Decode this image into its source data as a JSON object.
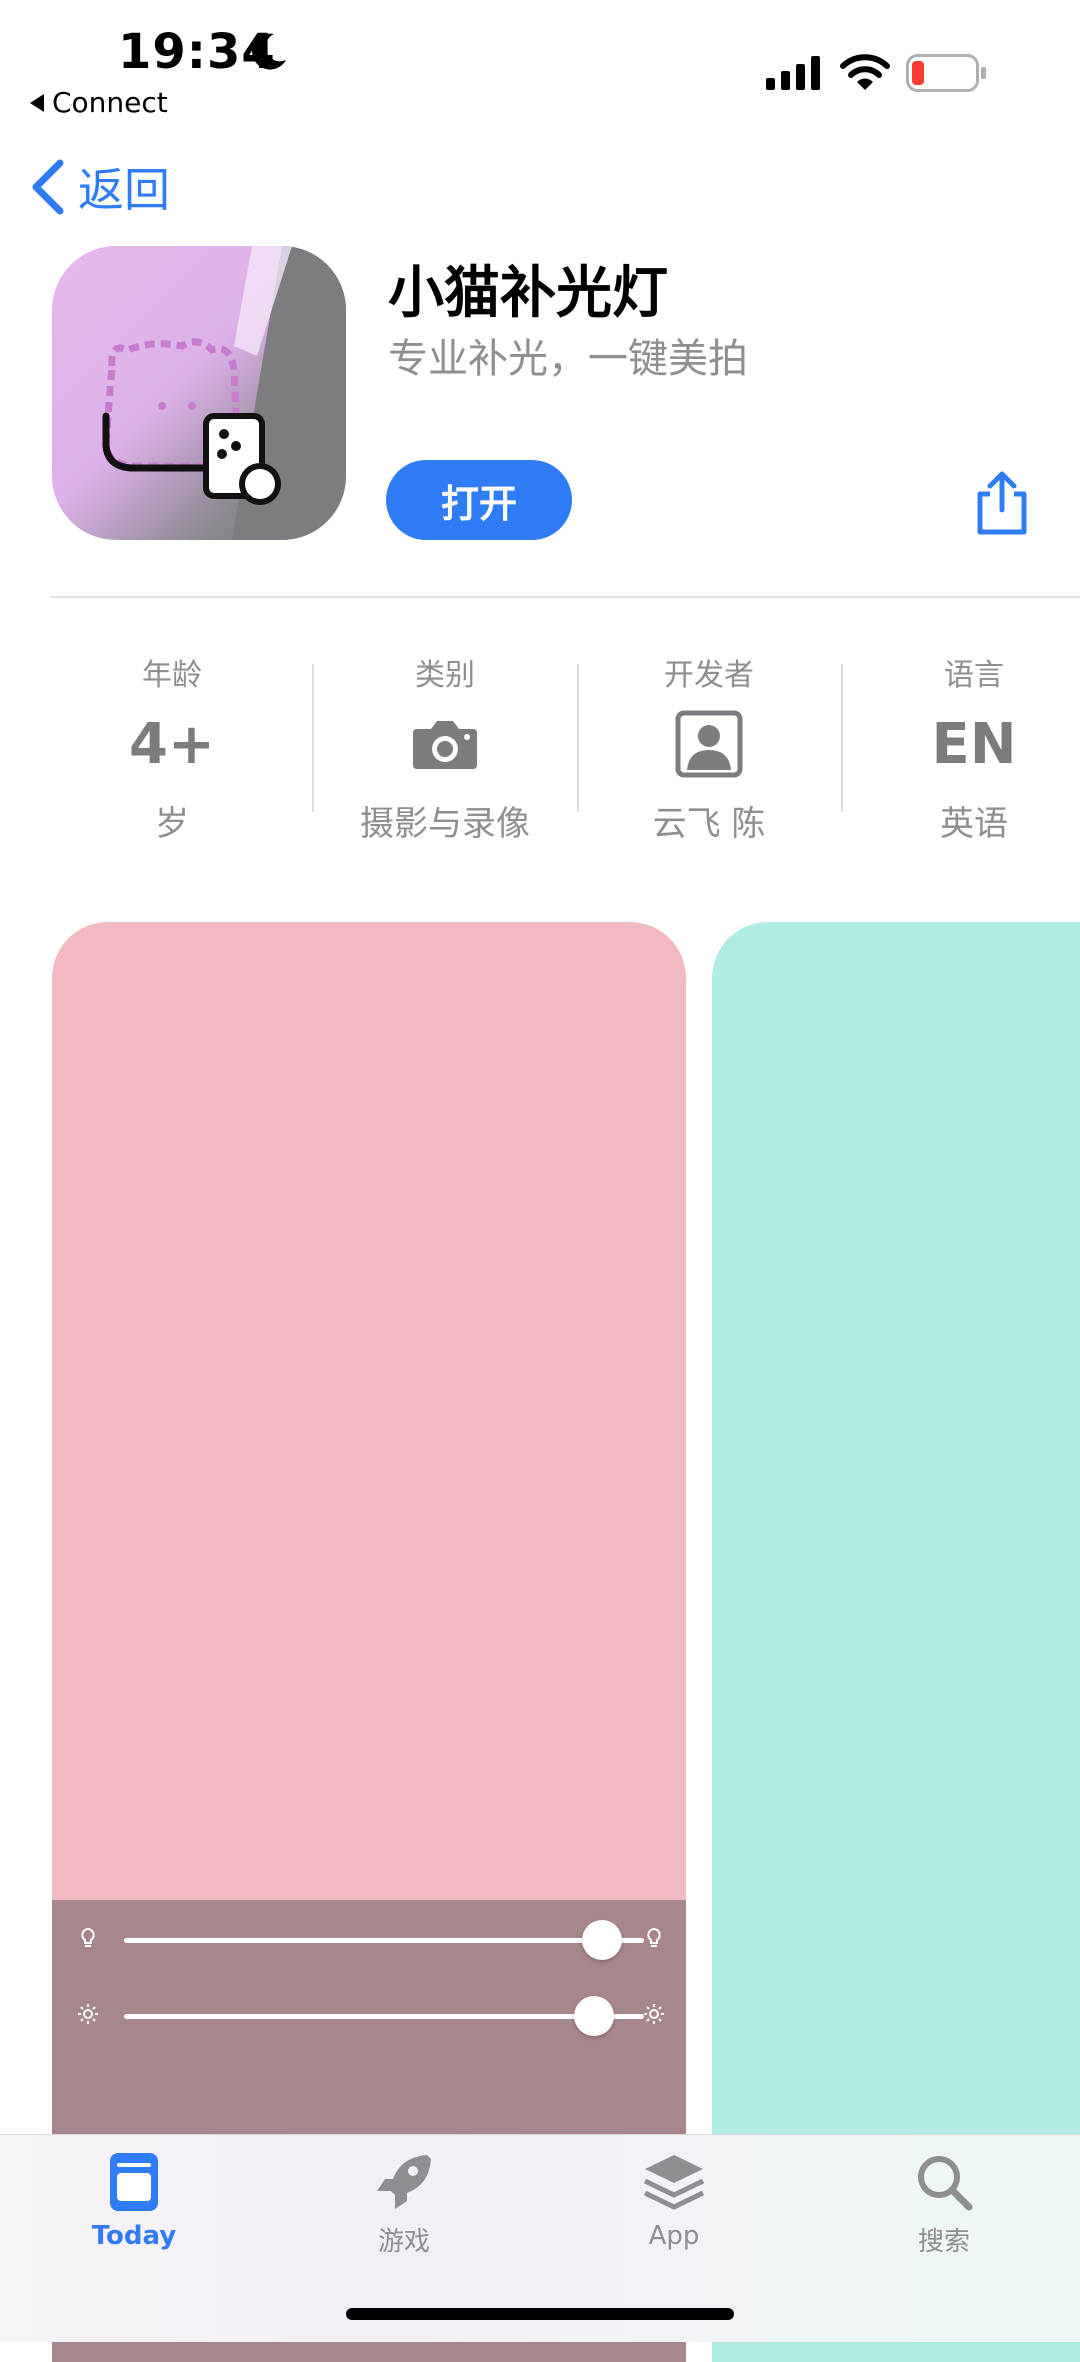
{
  "status_bar": {
    "time": "19:34",
    "back_app": "Connect"
  },
  "nav": {
    "back_label": "返回"
  },
  "app": {
    "name": "小猫补光灯",
    "subtitle": "专业补光，一键美拍",
    "open_label": "打开"
  },
  "info": [
    {
      "label": "年龄",
      "value": "4+",
      "sub": "岁"
    },
    {
      "label": "类别",
      "icon": "camera-icon",
      "sub": "摄影与录像"
    },
    {
      "label": "开发者",
      "icon": "person-icon",
      "sub": "云飞 陈"
    },
    {
      "label": "语言",
      "value": "EN",
      "sub": "英语"
    }
  ],
  "screenshots": {
    "shot1_color": "#f2b9c0",
    "shot2_color": "#b0ebe4",
    "slider_levels": [
      0.99,
      0.98
    ]
  },
  "tabs": [
    {
      "label": "Today",
      "icon": "today-icon",
      "active": true
    },
    {
      "label": "游戏",
      "icon": "rocket-icon",
      "active": false
    },
    {
      "label": "App",
      "icon": "layers-icon",
      "active": false
    },
    {
      "label": "搜索",
      "icon": "search-icon",
      "active": false
    }
  ],
  "colors": {
    "accent": "#2f7cf6",
    "secondary_text": "#8e8e93"
  }
}
